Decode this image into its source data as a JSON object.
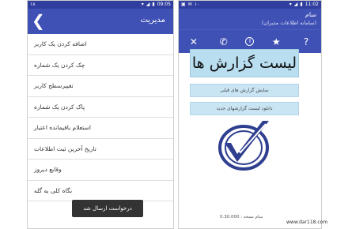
{
  "left_phone": {
    "status": {
      "clock": "09:05",
      "badge": "۱۸"
    },
    "appbar": {
      "title": "مدیریت"
    },
    "menu": [
      {
        "label": "اضافه کردن یک کاربر"
      },
      {
        "label": "چک کردن یک شماره"
      },
      {
        "label": "تغییرسطح کاربر"
      },
      {
        "label": "پاک کردن یک شماره"
      },
      {
        "label": "استعلام باقیمانده اعتبار"
      },
      {
        "label": "تاریخ آخرین ثبت اطلاعات"
      },
      {
        "label": "وقایع دیروز"
      },
      {
        "label": "نگاه کلی به گله"
      }
    ],
    "toast": "درخواست ارسال شد"
  },
  "right_phone": {
    "status": {
      "clock": "11:02",
      "badge": "۱۰"
    },
    "appbar": {
      "name": "سام",
      "subtitle": "(سامانه اطلاعات مدیران)"
    },
    "toolbar_icons": [
      "close-icon",
      "phone-icon",
      "info-icon",
      "star-icon",
      "question-icon"
    ],
    "toolbar_glyphs": {
      "close": "✕",
      "phone": "✆",
      "info": "i",
      "star": "★",
      "help": "?"
    },
    "title_box": "لیست گزارش ها",
    "buttons": {
      "previous_reports": "نمایش گزارش های قبلی",
      "download_new": "دانلود لیست گزارشهای جدید"
    },
    "version": "0.30.000 : سام نسخه"
  },
  "watermark": "www.dar118.com",
  "colors": {
    "primary": "#3f51b5",
    "status_bar": "#303f9f",
    "button_bg": "#c9e5f4",
    "title_bg": "#b8def0",
    "logo": "#2f3f8f"
  }
}
